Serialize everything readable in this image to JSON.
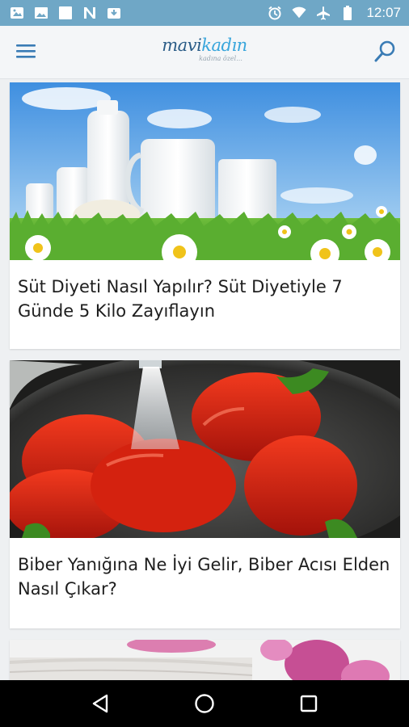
{
  "status_bar": {
    "time": "12:07",
    "left_icons": [
      "image-icon",
      "gallery-icon",
      "blank-notification-icon",
      "n-app-icon",
      "download-box-icon"
    ],
    "right_icons": [
      "alarm-icon",
      "wifi-icon",
      "airplane-mode-icon",
      "battery-icon"
    ]
  },
  "app_bar": {
    "logo_part1": "mavi",
    "logo_part2": "kadın",
    "tagline": "kadına özel...",
    "menu_icon": "hamburger-menu-icon",
    "search_icon": "search-icon"
  },
  "articles": [
    {
      "title": "Süt Diyeti Nasıl Yapılır? Süt Diyetiyle 7 Günde 5 Kilo Zayıflayın",
      "image": "milk-bottles-daisies-photo"
    },
    {
      "title": "Biber Yanığına Ne İyi Gelir, Biber Acısı Elden Nasıl Çıkar?",
      "image": "red-peppers-colander-photo"
    },
    {
      "title": "",
      "image": "towels-pink-flowers-photo"
    }
  ],
  "nav_bar": {
    "back_icon": "back-triangle-icon",
    "home_icon": "home-circle-icon",
    "recents_icon": "recents-square-icon"
  },
  "colors": {
    "status_bar": "#6fa7c6",
    "app_bar": "#f4f6f8",
    "logo_dark": "#2a5c87",
    "logo_light": "#39a6dc",
    "background": "#eef0f2"
  }
}
